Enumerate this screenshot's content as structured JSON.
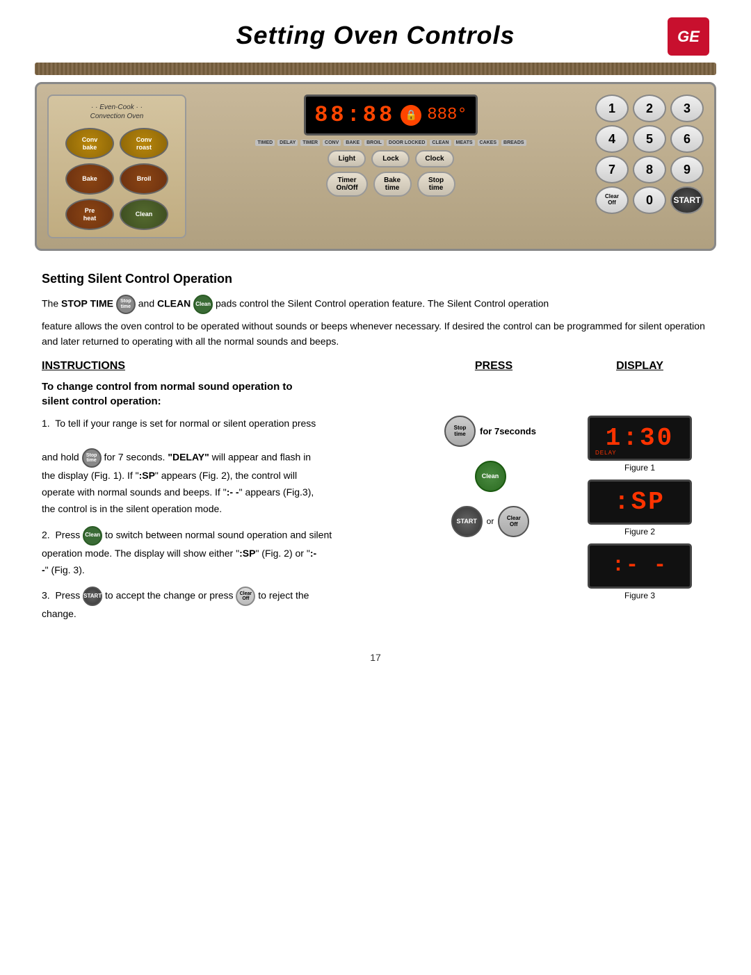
{
  "header": {
    "title": "Setting Oven Controls",
    "logo": "GE"
  },
  "oven": {
    "brand_line1": "· · Even-Cook · ·",
    "brand_line2": "Convection Oven",
    "buttons": {
      "conv_bake": "Conv\nbake",
      "conv_roast": "Conv\nroast",
      "bake": "Bake",
      "broil": "Broil",
      "pre_heat": "Pre\nheat",
      "clean": "Clean"
    },
    "display": {
      "digits": "88:88",
      "temp": "888°"
    },
    "display_labels": [
      "TIMED",
      "DELAY",
      "TIMER",
      "CONV",
      "BAKE",
      "BROIL",
      "DOOR LOCKED",
      "CLEAN",
      "MEATS",
      "CAKES",
      "BREADS"
    ],
    "control_buttons": [
      "Light",
      "Lock",
      "Clock",
      "Timer On/Off",
      "Bake time",
      "Stop time"
    ],
    "numpad": [
      "1",
      "2",
      "3",
      "4",
      "5",
      "6",
      "7",
      "8",
      "9",
      "Clear Off",
      "0",
      "START"
    ]
  },
  "section": {
    "title": "Setting Silent Control Operation",
    "intro1": "The STOP TIME",
    "intro_stoptime": "Stop time",
    "intro2": "and CLEAN",
    "intro_clean": "Clean",
    "intro3": "pads control the Silent Control operation feature. The Silent Control operation",
    "intro4": "feature allows the oven control to be operated without sounds or beeps whenever necessary. If desired the control can be programmed for silent operation and later returned to operating with all the normal sounds and beeps."
  },
  "instructions": {
    "col1_header": "INSTRUCTIONS",
    "col2_header": "PRESS",
    "col3_header": "DISPLAY",
    "sub_title_line1": "To change control from normal sound operation to",
    "sub_title_line2": "silent control operation:",
    "steps": [
      {
        "number": "1.",
        "text_parts": [
          "To tell if your range is set for normal or silent operation press",
          "and hold",
          "for 7 seconds. \"DELAY\" will appear and flash in",
          "the display (Fig. 1). If \":SP\" appears (Fig. 2), the control will",
          "operate with normal sounds and beeps.  If \":- -\" appears (Fig.3),",
          "the control is in the silent operation mode."
        ]
      },
      {
        "number": "2.",
        "text_parts": [
          "Press",
          "to switch between normal sound operation and silent",
          "operation mode. The display will show either \":SP\" (Fig. 2) or \":-",
          "-\" (Fig. 3)."
        ]
      },
      {
        "number": "3.",
        "text_parts": [
          "Press",
          "to accept the change or press",
          "to reject the",
          "change."
        ]
      }
    ],
    "press_labels": {
      "stop_time": "Stop\ntime",
      "for_7_seconds": "for 7seconds",
      "clean": "Clean",
      "start": "START",
      "clear_off": "Clear\nOff"
    },
    "figures": [
      {
        "caption": "Figure 1",
        "digits": "1:30",
        "sublabel": "DELAY"
      },
      {
        "caption": "Figure 2",
        "digits": ":SP",
        "sublabel": ""
      },
      {
        "caption": "Figure 3",
        "digits": ":- -",
        "sublabel": ""
      }
    ]
  },
  "page_number": "17"
}
